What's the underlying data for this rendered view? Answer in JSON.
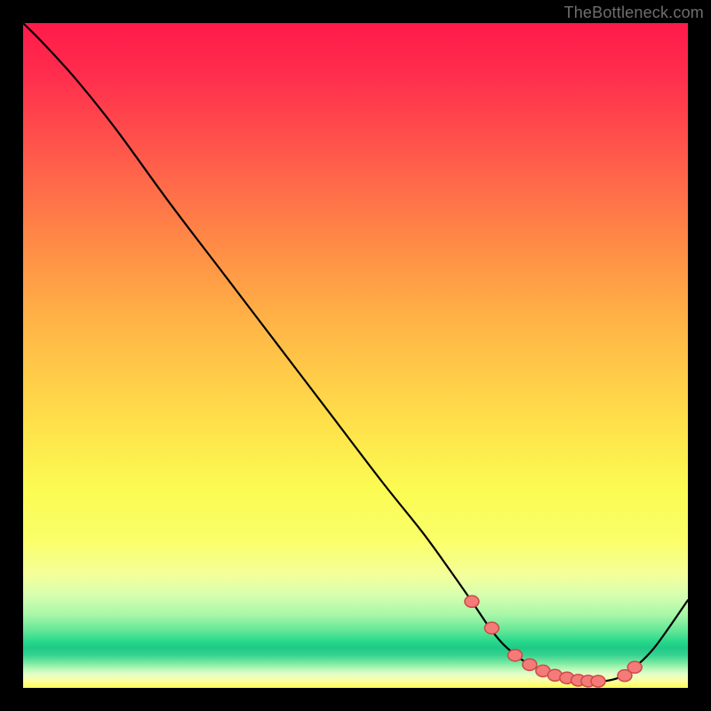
{
  "attribution": "TheBottleneck.com",
  "colors": {
    "marker_fill": "#f57b79",
    "marker_stroke": "#cc4a48",
    "curve": "#000000"
  },
  "chart_data": {
    "type": "line",
    "title": "",
    "xlabel": "",
    "ylabel": "",
    "xlim": [
      0,
      100
    ],
    "ylim": [
      0,
      100
    ],
    "x": [
      0,
      3,
      8,
      14,
      22,
      30,
      38,
      46,
      54,
      60,
      64,
      67.5,
      70,
      72,
      74,
      76,
      78,
      80,
      82,
      84,
      86,
      88,
      90,
      92,
      95,
      100
    ],
    "y": [
      100,
      97,
      91.5,
      84,
      73,
      62.5,
      52,
      41.5,
      31,
      23.5,
      18,
      13,
      9.3,
      6.8,
      5.0,
      3.6,
      2.6,
      1.9,
      1.4,
      1.1,
      1.0,
      1.1,
      1.7,
      3.1,
      6.1,
      13.2
    ],
    "markers": {
      "x": [
        67.5,
        70.5,
        74,
        76.2,
        78.2,
        80,
        81.8,
        83.5,
        85,
        86.5,
        90.5,
        92
      ],
      "y": [
        13.0,
        9.0,
        4.9,
        3.5,
        2.55,
        1.9,
        1.5,
        1.15,
        1.02,
        1.0,
        1.85,
        3.1
      ]
    }
  }
}
